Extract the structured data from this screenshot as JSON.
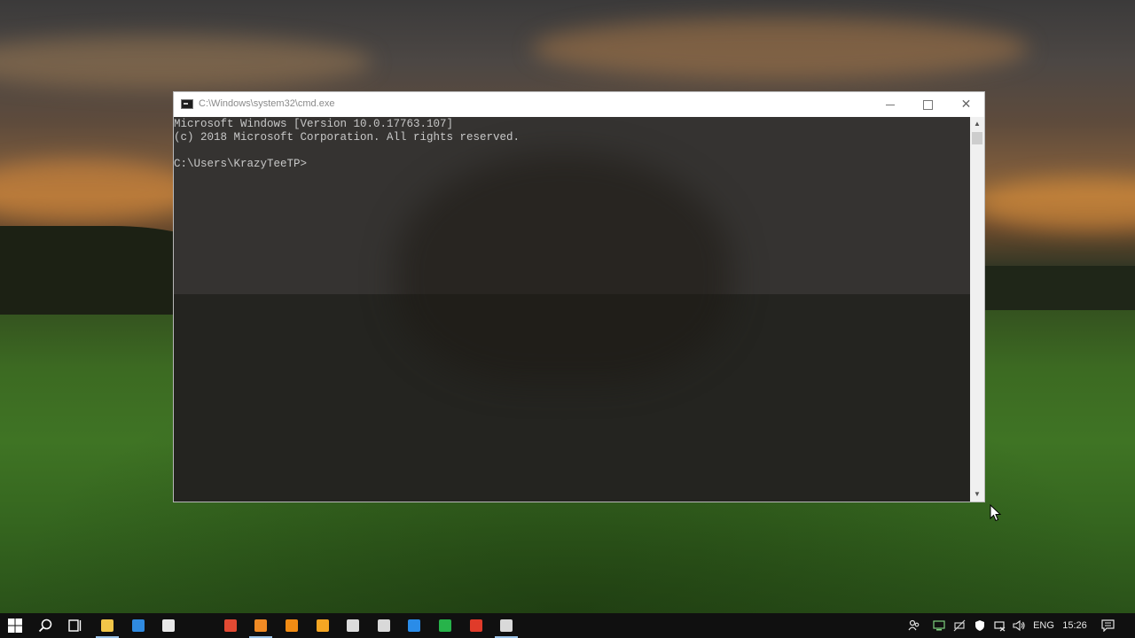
{
  "window": {
    "title": "C:\\Windows\\system32\\cmd.exe",
    "minimize_label": "minimize",
    "maximize_label": "maximize",
    "close_label": "✕"
  },
  "console": {
    "lines": [
      "Microsoft Windows [Version 10.0.17763.107]",
      "(c) 2018 Microsoft Corporation. All rights reserved.",
      "C:\\Users\\KrazyTeeTP>"
    ]
  },
  "taskbar": {
    "apps": [
      {
        "name": "file-explorer",
        "color": "#f2c649",
        "running": true
      },
      {
        "name": "edge",
        "color": "#2f8ae0",
        "running": false
      },
      {
        "name": "store",
        "color": "#e8e8e8",
        "running": false
      },
      {
        "name": "chrome",
        "color": "#e24a33",
        "running": false
      },
      {
        "name": "sublime-text",
        "color": "#f08a24",
        "running": true
      },
      {
        "name": "vlc",
        "color": "#f28c14",
        "running": false
      },
      {
        "name": "app-orange-triangle",
        "color": "#f5a623",
        "running": false
      },
      {
        "name": "notepad-app",
        "color": "#dcdcdc",
        "running": false
      },
      {
        "name": "phone-app",
        "color": "#d9d9d9",
        "running": false
      },
      {
        "name": "windows-app",
        "color": "#2a8ce8",
        "running": false
      },
      {
        "name": "camtasia-green",
        "color": "#27b34a",
        "running": false
      },
      {
        "name": "camtasia-red",
        "color": "#e03b2a",
        "running": false
      },
      {
        "name": "command-prompt",
        "color": "#d9d9d9",
        "running": true
      }
    ],
    "language": "ENG",
    "time": "15:26"
  }
}
